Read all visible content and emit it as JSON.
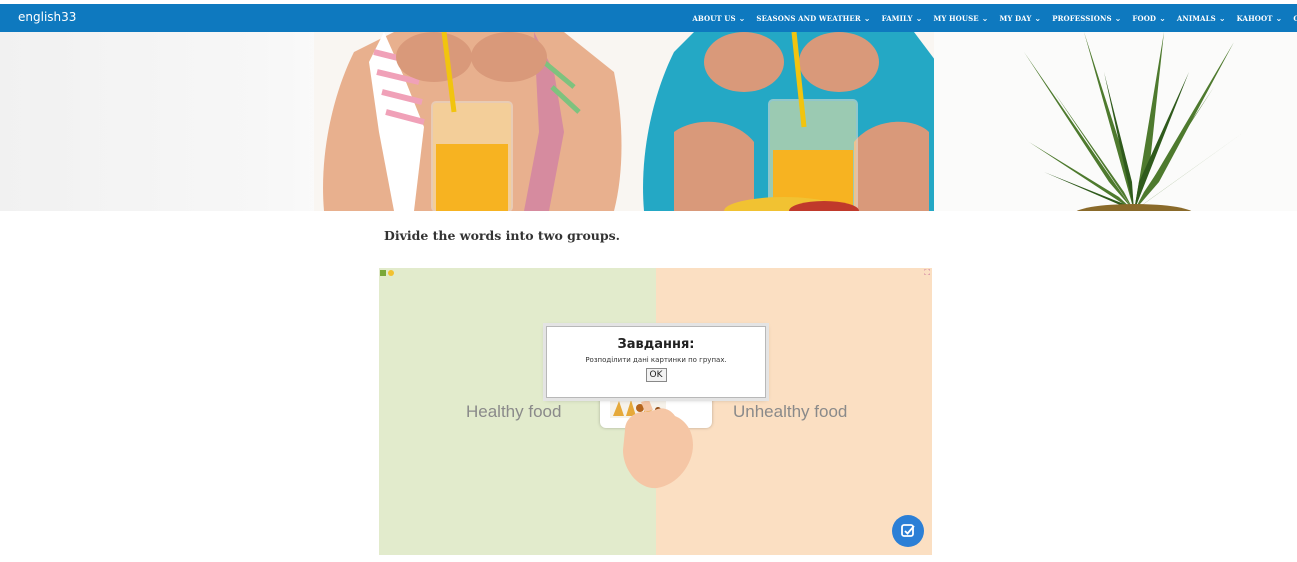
{
  "header": {
    "brand": "english33",
    "nav": [
      {
        "label": "ABOUT US",
        "chevron": "⌄"
      },
      {
        "label": "SEASONS AND WEATHER",
        "chevron": "⌄"
      },
      {
        "label": "FAMILY",
        "chevron": "⌄"
      },
      {
        "label": "MY HOUSE",
        "chevron": "⌄"
      },
      {
        "label": "MY DAY",
        "chevron": "⌄"
      },
      {
        "label": "PROFESSIONS",
        "chevron": "⌄"
      },
      {
        "label": "FOOD",
        "chevron": "⌄"
      },
      {
        "label": "ANIMALS",
        "chevron": "⌄"
      },
      {
        "label": "KAHOOT",
        "chevron": "⌄"
      },
      {
        "label": "C",
        "chevron": ""
      }
    ],
    "background": "#0e79bf"
  },
  "content": {
    "instruction": "Divide the words into two groups."
  },
  "activity": {
    "left_label": "Healthy food",
    "right_label": "Unhealthy food",
    "left_color": "#e2ebcc",
    "right_color": "#fbdfc2",
    "dialog": {
      "title": "Завдання:",
      "text": "Розподілити дані картинки по групах.",
      "ok_label": "OK"
    },
    "check_button_color": "#2b7fd6"
  }
}
